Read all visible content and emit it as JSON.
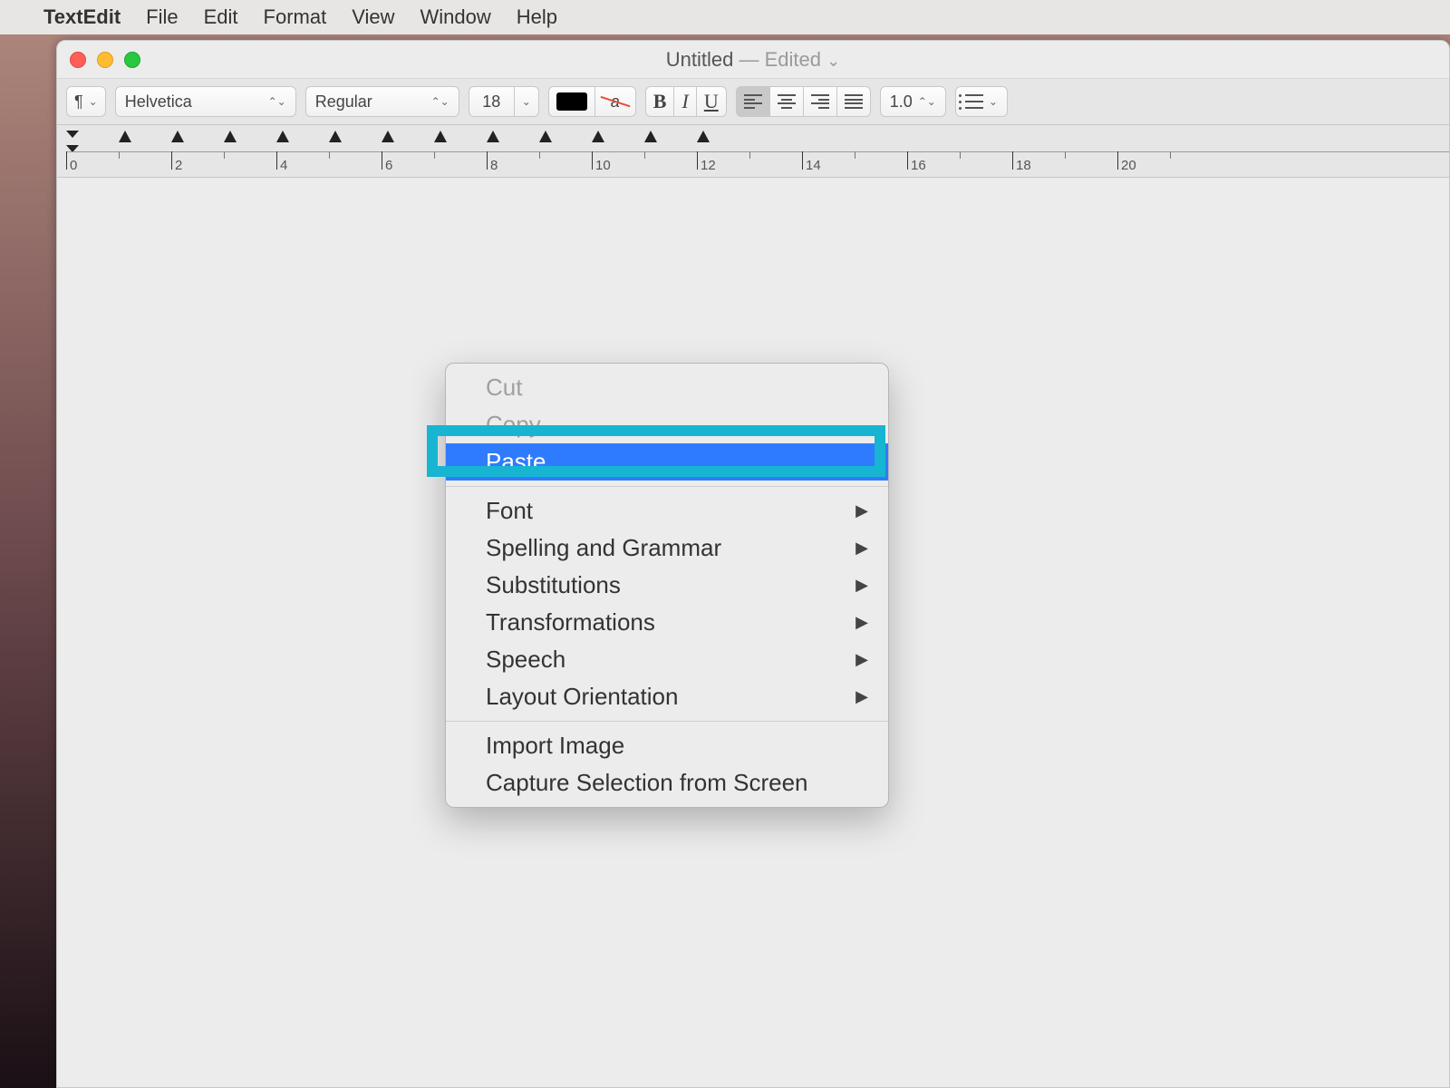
{
  "menubar": {
    "app_name": "TextEdit",
    "items": [
      "File",
      "Edit",
      "Format",
      "View",
      "Window",
      "Help"
    ]
  },
  "window": {
    "title": "Untitled",
    "edited_label": "— Edited"
  },
  "toolbar": {
    "paragraph_symbol": "¶",
    "font_family": "Helvetica",
    "font_style": "Regular",
    "font_size": "18",
    "line_spacing": "1.0"
  },
  "ruler": {
    "major_ticks": [
      0,
      2,
      4,
      6,
      8,
      10,
      12,
      14,
      16,
      18,
      20
    ]
  },
  "context_menu": {
    "items": [
      {
        "label": "Cut",
        "enabled": false,
        "submenu": false
      },
      {
        "label": "Copy",
        "enabled": false,
        "submenu": false
      },
      {
        "label": "Paste",
        "enabled": true,
        "submenu": false,
        "selected": true
      },
      {
        "separator": true
      },
      {
        "label": "Font",
        "enabled": true,
        "submenu": true
      },
      {
        "label": "Spelling and Grammar",
        "enabled": true,
        "submenu": true
      },
      {
        "label": "Substitutions",
        "enabled": true,
        "submenu": true
      },
      {
        "label": "Transformations",
        "enabled": true,
        "submenu": true
      },
      {
        "label": "Speech",
        "enabled": true,
        "submenu": true
      },
      {
        "label": "Layout Orientation",
        "enabled": true,
        "submenu": true
      },
      {
        "separator": true
      },
      {
        "label": "Import Image",
        "enabled": true,
        "submenu": false
      },
      {
        "label": "Capture Selection from Screen",
        "enabled": true,
        "submenu": false
      }
    ]
  }
}
